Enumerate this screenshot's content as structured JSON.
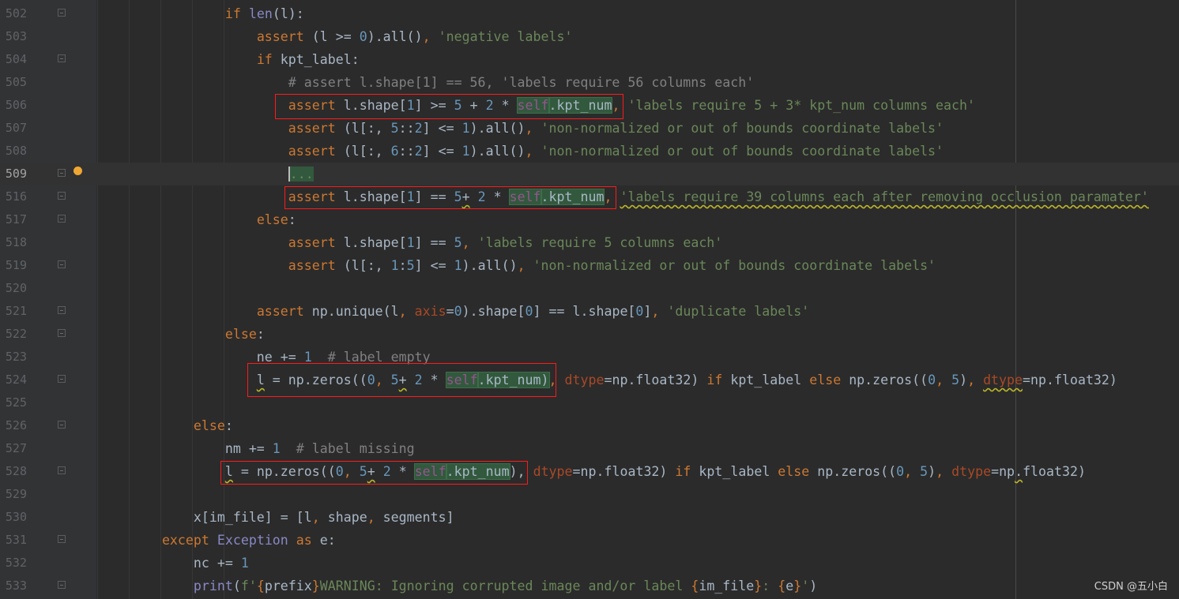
{
  "editor": {
    "current_line": 509,
    "lines": [
      {
        "num": "502",
        "fold": true,
        "tokens": [
          [
            "t",
            "                "
          ],
          [
            "k",
            "if "
          ],
          [
            "b",
            "len"
          ],
          [
            "t",
            "(l):"
          ]
        ]
      },
      {
        "num": "503",
        "tokens": [
          [
            "t",
            "                    "
          ],
          [
            "k",
            "assert "
          ],
          [
            "t",
            "(l >= "
          ],
          [
            "n",
            "0"
          ],
          [
            "t",
            ").all()"
          ],
          [
            "k",
            ", "
          ],
          [
            "s",
            "'negative labels'"
          ]
        ]
      },
      {
        "num": "504",
        "fold": true,
        "tokens": [
          [
            "t",
            "                    "
          ],
          [
            "k",
            "if "
          ],
          [
            "t",
            "kpt_label:"
          ]
        ]
      },
      {
        "num": "505",
        "tokens": [
          [
            "t",
            "                        "
          ],
          [
            "c",
            "# assert l.shape[1] == 56, 'labels require 56 columns each'"
          ]
        ]
      },
      {
        "num": "506",
        "tokens": [
          [
            "t",
            "                        "
          ],
          [
            "k",
            "assert "
          ],
          [
            "t",
            "l.shape["
          ],
          [
            "n",
            "1"
          ],
          [
            "t",
            "] >= "
          ],
          [
            "n",
            "5 "
          ],
          [
            "t",
            "+ "
          ],
          [
            "n",
            "2 "
          ],
          [
            "t",
            "* "
          ],
          [
            "self hl",
            "self"
          ],
          [
            "t hl",
            ".kpt_num"
          ],
          [
            "k",
            ", "
          ],
          [
            "s",
            "'labels require 5 + 3* kpt_num columns each'"
          ]
        ]
      },
      {
        "num": "507",
        "tokens": [
          [
            "t",
            "                        "
          ],
          [
            "k",
            "assert "
          ],
          [
            "t",
            "(l[:, "
          ],
          [
            "n",
            "5"
          ],
          [
            "t",
            "::"
          ],
          [
            "n",
            "2"
          ],
          [
            "t",
            "] <= "
          ],
          [
            "n",
            "1"
          ],
          [
            "t",
            ").all()"
          ],
          [
            "k",
            ", "
          ],
          [
            "s",
            "'non-normalized or out of bounds coordinate labels'"
          ]
        ]
      },
      {
        "num": "508",
        "tokens": [
          [
            "t",
            "                        "
          ],
          [
            "k",
            "assert "
          ],
          [
            "t",
            "(l[:, "
          ],
          [
            "n",
            "6"
          ],
          [
            "t",
            "::"
          ],
          [
            "n",
            "2"
          ],
          [
            "t",
            "] <= "
          ],
          [
            "n",
            "1"
          ],
          [
            "t",
            ").all()"
          ],
          [
            "k",
            ", "
          ],
          [
            "s",
            "'non-normalized or out of bounds coordinate labels'"
          ]
        ]
      },
      {
        "num": "509",
        "fold": true,
        "bulb": true,
        "tokens": [
          [
            "t",
            "                        "
          ],
          [
            "fold-txt",
            "..."
          ]
        ]
      },
      {
        "num": "516",
        "fold": true,
        "tokens": [
          [
            "t",
            "                        "
          ],
          [
            "k",
            "assert "
          ],
          [
            "t",
            "l.shape["
          ],
          [
            "n",
            "1"
          ],
          [
            "t",
            "] == "
          ],
          [
            "n",
            "5"
          ],
          [
            "t warn",
            "+"
          ],
          [
            "t",
            " "
          ],
          [
            "n",
            "2 "
          ],
          [
            "t",
            "* "
          ],
          [
            "self hl",
            "self"
          ],
          [
            "t hl",
            ".kpt_num"
          ],
          [
            "k",
            ", "
          ],
          [
            "s warn",
            "'labels require 39 columns each after removing occlusion paramater'"
          ]
        ]
      },
      {
        "num": "517",
        "fold": true,
        "tokens": [
          [
            "t",
            "                    "
          ],
          [
            "k",
            "else"
          ],
          [
            "t",
            ":"
          ]
        ]
      },
      {
        "num": "518",
        "tokens": [
          [
            "t",
            "                        "
          ],
          [
            "k",
            "assert "
          ],
          [
            "t",
            "l.shape["
          ],
          [
            "n",
            "1"
          ],
          [
            "t",
            "] == "
          ],
          [
            "n",
            "5"
          ],
          [
            "k",
            ", "
          ],
          [
            "s",
            "'labels require 5 columns each'"
          ]
        ]
      },
      {
        "num": "519",
        "fold": true,
        "tokens": [
          [
            "t",
            "                        "
          ],
          [
            "k",
            "assert "
          ],
          [
            "t",
            "(l[:, "
          ],
          [
            "n",
            "1"
          ],
          [
            "t",
            ":"
          ],
          [
            "n",
            "5"
          ],
          [
            "t",
            "] <= "
          ],
          [
            "n",
            "1"
          ],
          [
            "t",
            ").all()"
          ],
          [
            "k",
            ", "
          ],
          [
            "s",
            "'non-normalized or out of bounds coordinate labels'"
          ]
        ]
      },
      {
        "num": "520",
        "tokens": []
      },
      {
        "num": "521",
        "fold": true,
        "tokens": [
          [
            "t",
            "                    "
          ],
          [
            "k",
            "assert "
          ],
          [
            "t",
            "np.unique(l"
          ],
          [
            "k",
            ", "
          ],
          [
            "p",
            "axis"
          ],
          [
            "t",
            "="
          ],
          [
            "n",
            "0"
          ],
          [
            "t",
            ").shape["
          ],
          [
            "n",
            "0"
          ],
          [
            "t",
            "] == l.shape["
          ],
          [
            "n",
            "0"
          ],
          [
            "t",
            "]"
          ],
          [
            "k",
            ", "
          ],
          [
            "s",
            "'duplicate labels'"
          ]
        ]
      },
      {
        "num": "522",
        "fold": true,
        "tokens": [
          [
            "t",
            "                "
          ],
          [
            "k",
            "else"
          ],
          [
            "t",
            ":"
          ]
        ]
      },
      {
        "num": "523",
        "tokens": [
          [
            "t",
            "                    ne += "
          ],
          [
            "n",
            "1  "
          ],
          [
            "c",
            "# label empty"
          ]
        ]
      },
      {
        "num": "524",
        "fold": true,
        "tokens": [
          [
            "t",
            "                    "
          ],
          [
            "t warn",
            "l"
          ],
          [
            "t",
            " = np.zeros(("
          ],
          [
            "n",
            "0"
          ],
          [
            "k",
            ", "
          ],
          [
            "n",
            "5"
          ],
          [
            "t warn",
            "+"
          ],
          [
            "t",
            " "
          ],
          [
            "n",
            "2 "
          ],
          [
            "t",
            "* "
          ],
          [
            "self hl",
            "self"
          ],
          [
            "t hl",
            ".kpt_num)"
          ],
          [
            "k",
            ", "
          ],
          [
            "p",
            "dtype"
          ],
          [
            "t",
            "=np.float32) "
          ],
          [
            "k",
            "if "
          ],
          [
            "t",
            "kpt_label "
          ],
          [
            "k",
            "else "
          ],
          [
            "t",
            "np.zeros(("
          ],
          [
            "n",
            "0"
          ],
          [
            "k",
            ", "
          ],
          [
            "n",
            "5"
          ],
          [
            "t",
            ")"
          ],
          [
            "k",
            ", "
          ],
          [
            "p warn",
            "dtype"
          ],
          [
            "t",
            "=np.float32)"
          ]
        ]
      },
      {
        "num": "525",
        "tokens": []
      },
      {
        "num": "526",
        "fold": true,
        "tokens": [
          [
            "t",
            "            "
          ],
          [
            "k",
            "else"
          ],
          [
            "t",
            ":"
          ]
        ]
      },
      {
        "num": "527",
        "tokens": [
          [
            "t",
            "                nm += "
          ],
          [
            "n",
            "1  "
          ],
          [
            "c",
            "# label missing"
          ]
        ]
      },
      {
        "num": "528",
        "fold": true,
        "tokens": [
          [
            "t",
            "                "
          ],
          [
            "t warn",
            "l"
          ],
          [
            "t",
            " = np.zeros(("
          ],
          [
            "n",
            "0"
          ],
          [
            "k",
            ", "
          ],
          [
            "n",
            "5"
          ],
          [
            "t warn",
            "+"
          ],
          [
            "t",
            " "
          ],
          [
            "n",
            "2 "
          ],
          [
            "t",
            "* "
          ],
          [
            "self hl",
            "self"
          ],
          [
            "t hl",
            ".kpt_num"
          ],
          [
            "t",
            "), "
          ],
          [
            "p",
            "dtype"
          ],
          [
            "t",
            "=np.float32) "
          ],
          [
            "k",
            "if "
          ],
          [
            "t",
            "kpt_label "
          ],
          [
            "k",
            "else "
          ],
          [
            "t",
            "np.zeros(("
          ],
          [
            "n",
            "0"
          ],
          [
            "k",
            ", "
          ],
          [
            "n",
            "5"
          ],
          [
            "t",
            ")"
          ],
          [
            "k",
            ", "
          ],
          [
            "p",
            "dtype"
          ],
          [
            "t",
            "=np"
          ],
          [
            "t warn",
            "."
          ],
          [
            "t",
            "float32)"
          ]
        ]
      },
      {
        "num": "529",
        "tokens": []
      },
      {
        "num": "530",
        "tokens": [
          [
            "t",
            "            x[im_file] = [l"
          ],
          [
            "k",
            ", "
          ],
          [
            "t",
            "shape"
          ],
          [
            "k",
            ", "
          ],
          [
            "t",
            "segments]"
          ]
        ]
      },
      {
        "num": "531",
        "fold": true,
        "tokens": [
          [
            "t",
            "        "
          ],
          [
            "k",
            "except "
          ],
          [
            "b",
            "Exception "
          ],
          [
            "k",
            "as "
          ],
          [
            "t",
            "e:"
          ]
        ]
      },
      {
        "num": "532",
        "tokens": [
          [
            "t",
            "            nc += "
          ],
          [
            "n",
            "1"
          ]
        ]
      },
      {
        "num": "533",
        "fold": true,
        "tokens": [
          [
            "t",
            "            "
          ],
          [
            "b",
            "print"
          ],
          [
            "t",
            "("
          ],
          [
            "s",
            "f'"
          ],
          [
            "k",
            "{"
          ],
          [
            "t",
            "prefix"
          ],
          [
            "k",
            "}"
          ],
          [
            "s",
            "WARNING: Ignoring corrupted image and/or label "
          ],
          [
            "k",
            "{"
          ],
          [
            "t",
            "im_file"
          ],
          [
            "k",
            "}"
          ],
          [
            "s",
            ": "
          ],
          [
            "k",
            "{"
          ],
          [
            "t",
            "e"
          ],
          [
            "k",
            "}"
          ],
          [
            "s",
            "'"
          ],
          [
            "t",
            ")"
          ]
        ]
      }
    ]
  },
  "watermark": "CSDN @五小白",
  "colors": {
    "background": "#2b2b2b",
    "keyword": "#cc7832",
    "string": "#6a8759",
    "number": "#6897bb",
    "annotation_box": "#ff1a1a"
  }
}
